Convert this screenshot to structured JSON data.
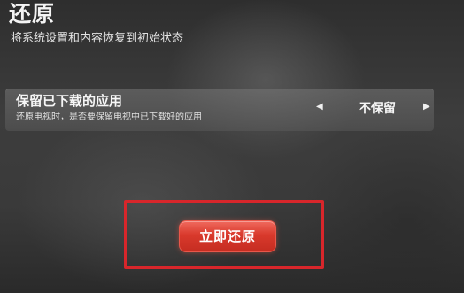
{
  "header": {
    "title": "还原",
    "subtitle": "将系统设置和内容恢复到初始状态"
  },
  "option": {
    "label": "保留已下载的应用",
    "description": "还原电视时，是否要保留电视中已下载好的应用",
    "value": "不保留",
    "left_arrow": "◀",
    "right_arrow": "▶"
  },
  "actions": {
    "restore_now_label": "立即还原"
  },
  "colors": {
    "accent_button": "#d9392c",
    "highlight_frame": "#d8262b"
  }
}
